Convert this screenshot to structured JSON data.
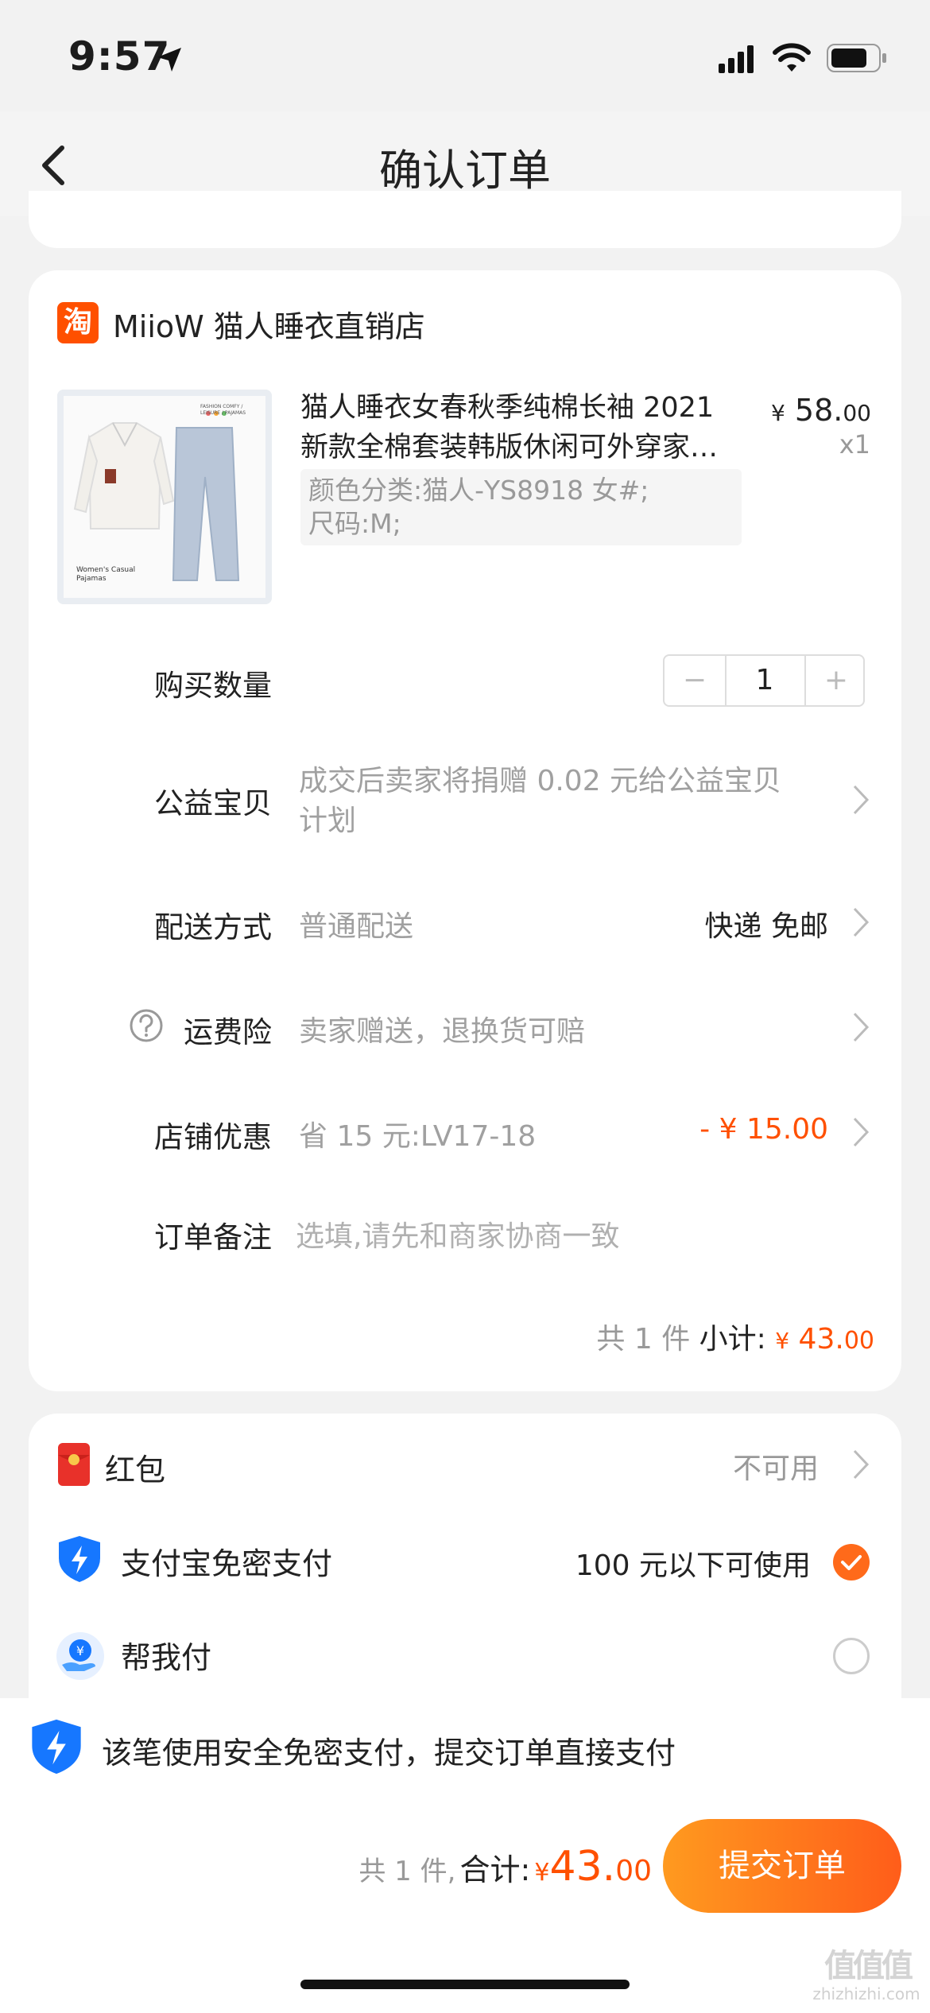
{
  "status": {
    "time": "9:57"
  },
  "nav": {
    "title": "确认订单"
  },
  "store": {
    "logo_char": "淘",
    "name": "MiioW 猫人睡衣直销店"
  },
  "product": {
    "title_line1": "猫人睡衣女春秋季纯棉长袖 2021",
    "title_line2": "新款全棉套装韩版休闲可外穿家…",
    "price_symbol": "¥",
    "price_int": "58.",
    "price_dec": "00",
    "quantity_label": "x1",
    "sku_line1": "颜色分类:猫人-YS8918 女#;",
    "sku_line2": "尺码:M;",
    "image_text_top": "FASHION COMFY / LEISURE / PAJAMAS",
    "image_text_bottom": "Women's Casual Pajamas"
  },
  "rows": {
    "quantity": {
      "label": "购买数量",
      "minus": "−",
      "value": "1",
      "plus": "+"
    },
    "charity": {
      "label": "公益宝贝",
      "line1": "成交后卖家将捐赠 0.02 元给公益宝贝",
      "line2": "计划"
    },
    "delivery": {
      "label": "配送方式",
      "value": "普通配送",
      "right": "快递 免邮"
    },
    "insurance": {
      "label": "运费险",
      "value": "卖家赠送，退换货可赔"
    },
    "store_discount": {
      "label": "店铺优惠",
      "value": "省 15 元:LV17-18",
      "right": "- ¥ 15.00"
    },
    "note": {
      "label": "订单备注",
      "placeholder": "选填,请先和商家协商一致"
    }
  },
  "subtotal": {
    "count": "共 1 件",
    "label": "小计:",
    "symbol": "¥",
    "int": "43.",
    "dec": "00"
  },
  "payment": {
    "redpacket": {
      "label": "红包",
      "value": "不可用"
    },
    "alipay": {
      "label": "支付宝免密支付",
      "value": "100 元以下可使用"
    },
    "helppay": {
      "label": "帮我付"
    }
  },
  "bottom": {
    "notice": "该笔使用安全免密支付，提交订单直接支付",
    "count": "共 1 件,",
    "total_label": "合计:",
    "symbol": "¥",
    "int": "43.",
    "dec": "00",
    "submit": "提交订单"
  },
  "watermark": {
    "logo": "值值值",
    "url": "zhizhizhi.com"
  },
  "colors": {
    "accent": "#ff5000",
    "alipay_blue": "#1677ff",
    "check_orange": "#ff6a1a"
  }
}
